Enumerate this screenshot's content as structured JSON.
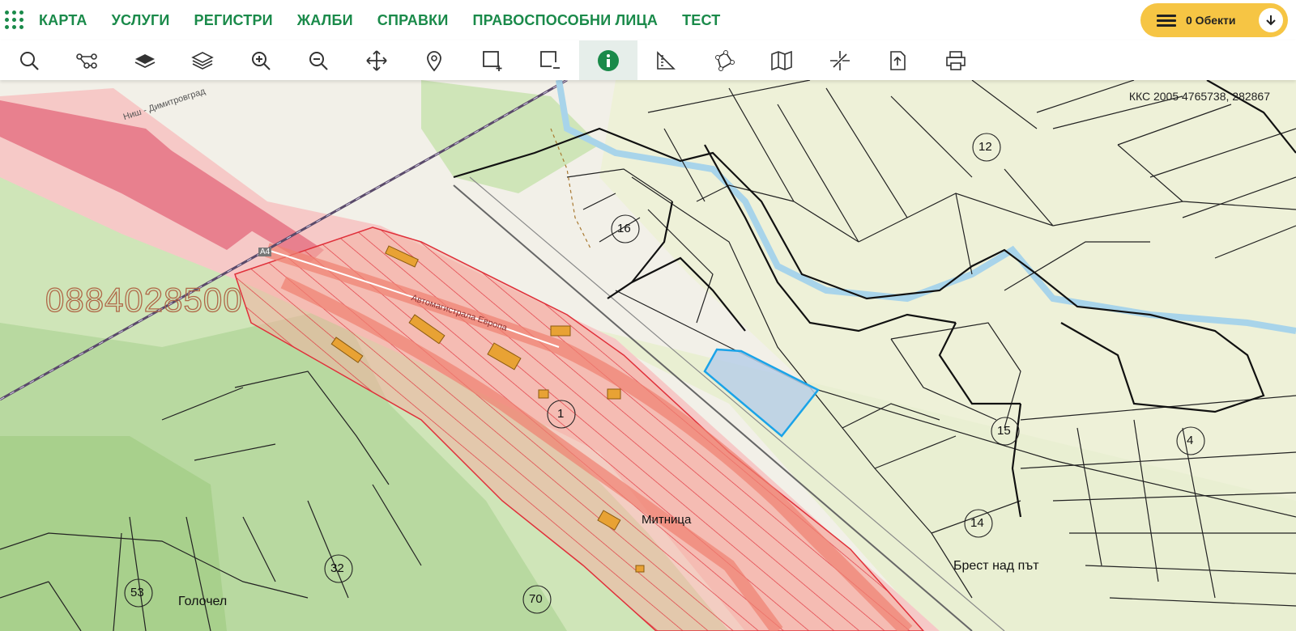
{
  "nav": {
    "items": [
      "КАРТА",
      "УСЛУГИ",
      "РЕГИСТРИ",
      "ЖАЛБИ",
      "СПРАВКИ",
      "ПРАВОСПОСОБНИ ЛИЦА",
      "ТЕСТ"
    ],
    "objects_label": "0 Обекти"
  },
  "toolbar": {
    "tools": [
      "search-icon",
      "network-icon",
      "layer-solid-icon",
      "layers-icon",
      "zoom-in-icon",
      "zoom-out-icon",
      "pan-icon",
      "pin-icon",
      "rect-add-icon",
      "rect-remove-icon",
      "info-icon",
      "measure-icon",
      "polygon-icon",
      "map-icon",
      "snap-icon",
      "export-icon",
      "print-icon"
    ],
    "active": "info-icon"
  },
  "map": {
    "coords": "ККС 2005 4765738, 282867",
    "watermark": "0884028500",
    "parcel_numbers": [
      "12",
      "16",
      "1",
      "15",
      "4",
      "14",
      "32",
      "53",
      "70"
    ],
    "places": [
      "Митница",
      "Брест над път",
      "Голочел"
    ],
    "roads": [
      "Автомагистрала Европа",
      "Ниш - Димитровград",
      "A4"
    ],
    "colors": {
      "accent": "#1a8a4a",
      "button": "#f6c544",
      "hatch": "#e0303a",
      "selection": "#1aa3e8"
    }
  }
}
